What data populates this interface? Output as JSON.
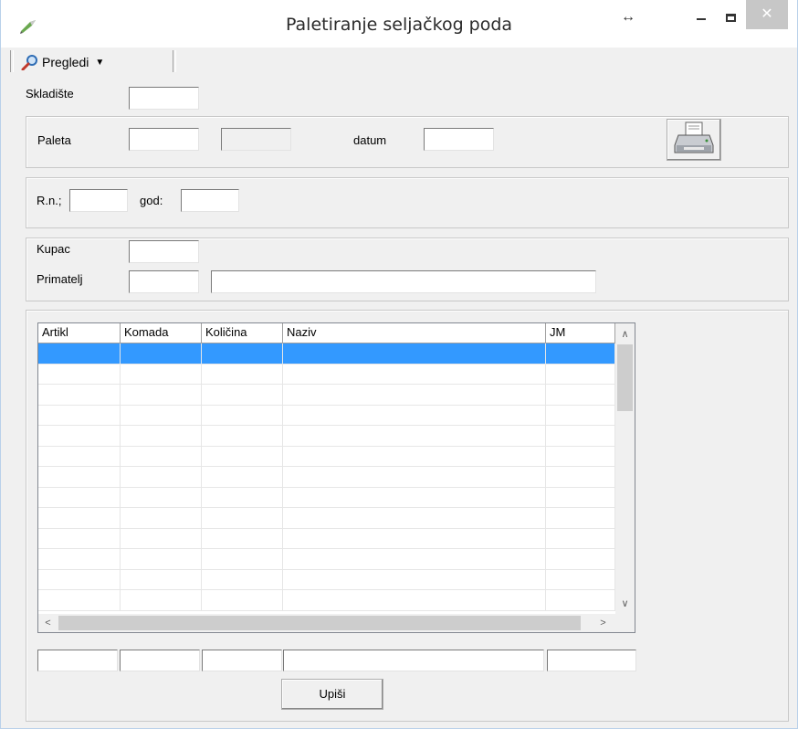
{
  "window": {
    "title": "Paletiranje seljačkog poda",
    "close_glyph": "✕",
    "resize_glyph": "↔"
  },
  "toolbar": {
    "pregledi_label": "Pregledi",
    "pregledi_icon": "magnifier-icon"
  },
  "form": {
    "skladiste_label": "Skladište",
    "skladiste_value": "",
    "paleta_label": "Paleta",
    "paleta_value": "",
    "paleta_extra_value": "",
    "datum_label": "datum",
    "datum_value": "",
    "rn_label": "R.n.;",
    "rn_value": "",
    "god_label": "god:",
    "god_value": "",
    "kupac_label": "Kupac",
    "kupac_value": "",
    "primatelj_label": "Primatelj",
    "primatelj_code": "",
    "primatelj_name": ""
  },
  "grid": {
    "columns": [
      "Artikl",
      "Komada",
      "Količina",
      "Naziv",
      "JM"
    ],
    "rows": 13,
    "selected_row": 0,
    "selection_color": "#3399ff",
    "scroll_up": "∧",
    "scroll_down": "∨",
    "scroll_left": "<",
    "scroll_right": ">"
  },
  "footer": {
    "upisi_label": "Upiši"
  }
}
